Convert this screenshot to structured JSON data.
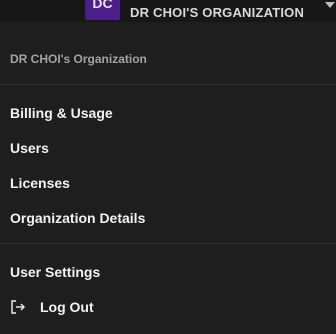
{
  "header": {
    "avatar_initials": "DC",
    "org_name": "DR CHOI'S ORGANIZATION",
    "dropdown_icon": "caret-down-icon"
  },
  "menu": {
    "section_title": "DR CHOI's Organization",
    "org_items": [
      {
        "label": "Billing & Usage"
      },
      {
        "label": "Users"
      },
      {
        "label": "Licenses"
      },
      {
        "label": "Organization Details"
      }
    ],
    "account_items": [
      {
        "label": "User Settings"
      },
      {
        "label": "Log Out",
        "icon": "log-out-icon"
      }
    ]
  },
  "colors": {
    "background": "#1e1e1e",
    "avatar": "#4b1e89",
    "text": "#f2f2f2",
    "muted_text": "#a3a3a3",
    "divider": "#333333"
  }
}
